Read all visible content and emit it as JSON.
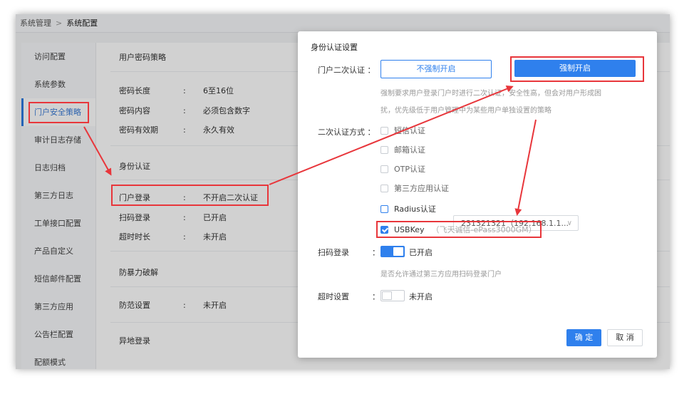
{
  "breadcrumb": {
    "parent": "系统管理",
    "separator": ">",
    "current": "系统配置"
  },
  "sidebar": {
    "items": [
      {
        "label": "访问配置"
      },
      {
        "label": "系统参数"
      },
      {
        "label": "门户安全策略",
        "active": true
      },
      {
        "label": "审计日志存储"
      },
      {
        "label": "日志归档"
      },
      {
        "label": "第三方日志"
      },
      {
        "label": "工单接口配置"
      },
      {
        "label": "产品自定义"
      },
      {
        "label": "短信邮件配置"
      },
      {
        "label": "第三方应用"
      },
      {
        "label": "公告栏配置"
      },
      {
        "label": "配额模式"
      }
    ]
  },
  "content": {
    "password_policy": {
      "title": "用户密码策略",
      "rows": [
        {
          "key": "密码长度",
          "colon": ":",
          "value": "6至16位"
        },
        {
          "key": "密码内容",
          "colon": ":",
          "value": "必须包含数字"
        },
        {
          "key": "密码有效期",
          "colon": ":",
          "value": "永久有效"
        }
      ]
    },
    "identity_auth": {
      "title": "身份认证",
      "rows": [
        {
          "key": "门户登录",
          "colon": ":",
          "value": "不开启二次认证"
        },
        {
          "key": "扫码登录",
          "colon": ":",
          "value": "已开启"
        },
        {
          "key": "超时时长",
          "colon": ":",
          "value": "未开启"
        }
      ]
    },
    "brute_force": {
      "title": "防暴力破解",
      "rows": [
        {
          "key": "防范设置",
          "colon": ":",
          "value": "未开启"
        }
      ]
    },
    "remote_login": {
      "title": "异地登录"
    }
  },
  "modal": {
    "title": "身份认证设置",
    "portal_2fa_label": "门户二次认证 ：",
    "not_force_label": "不强制开启",
    "force_label": "强制开启",
    "force_desc_line1": "强制要求用户登录门户时进行二次认证，安全性高，但会对用户形成困",
    "force_desc_line2": "扰，优先级低于用户管理中为某些用户单独设置的策略",
    "method_label": "二次认证方式 ：",
    "methods": [
      {
        "label": "短信认证",
        "checked": false
      },
      {
        "label": "邮箱认证",
        "checked": false
      },
      {
        "label": "OTP认证",
        "checked": false
      },
      {
        "label": "第三方应用认证",
        "checked": false
      },
      {
        "label": "Radius认证",
        "checked": false
      },
      {
        "label": "USBKey",
        "checked": true,
        "note": "（飞天诚信-ePass3000GM）"
      }
    ],
    "radius_select": {
      "value": "231321321（192.168.1.1...",
      "chevron_icon": "chevron-down-icon"
    },
    "scan_login": {
      "label": "扫码登录",
      "colon": "：",
      "state": "已开启",
      "on": true,
      "desc": "是否允许通过第三方应用扫码登录门户"
    },
    "timeout": {
      "label": "超时设置",
      "colon": "：",
      "state": "未开启",
      "on": false
    },
    "ok_label": "确 定",
    "cancel_label": "取 消"
  },
  "colors": {
    "primary": "#2f80ed",
    "annotation": "#e8363b"
  }
}
